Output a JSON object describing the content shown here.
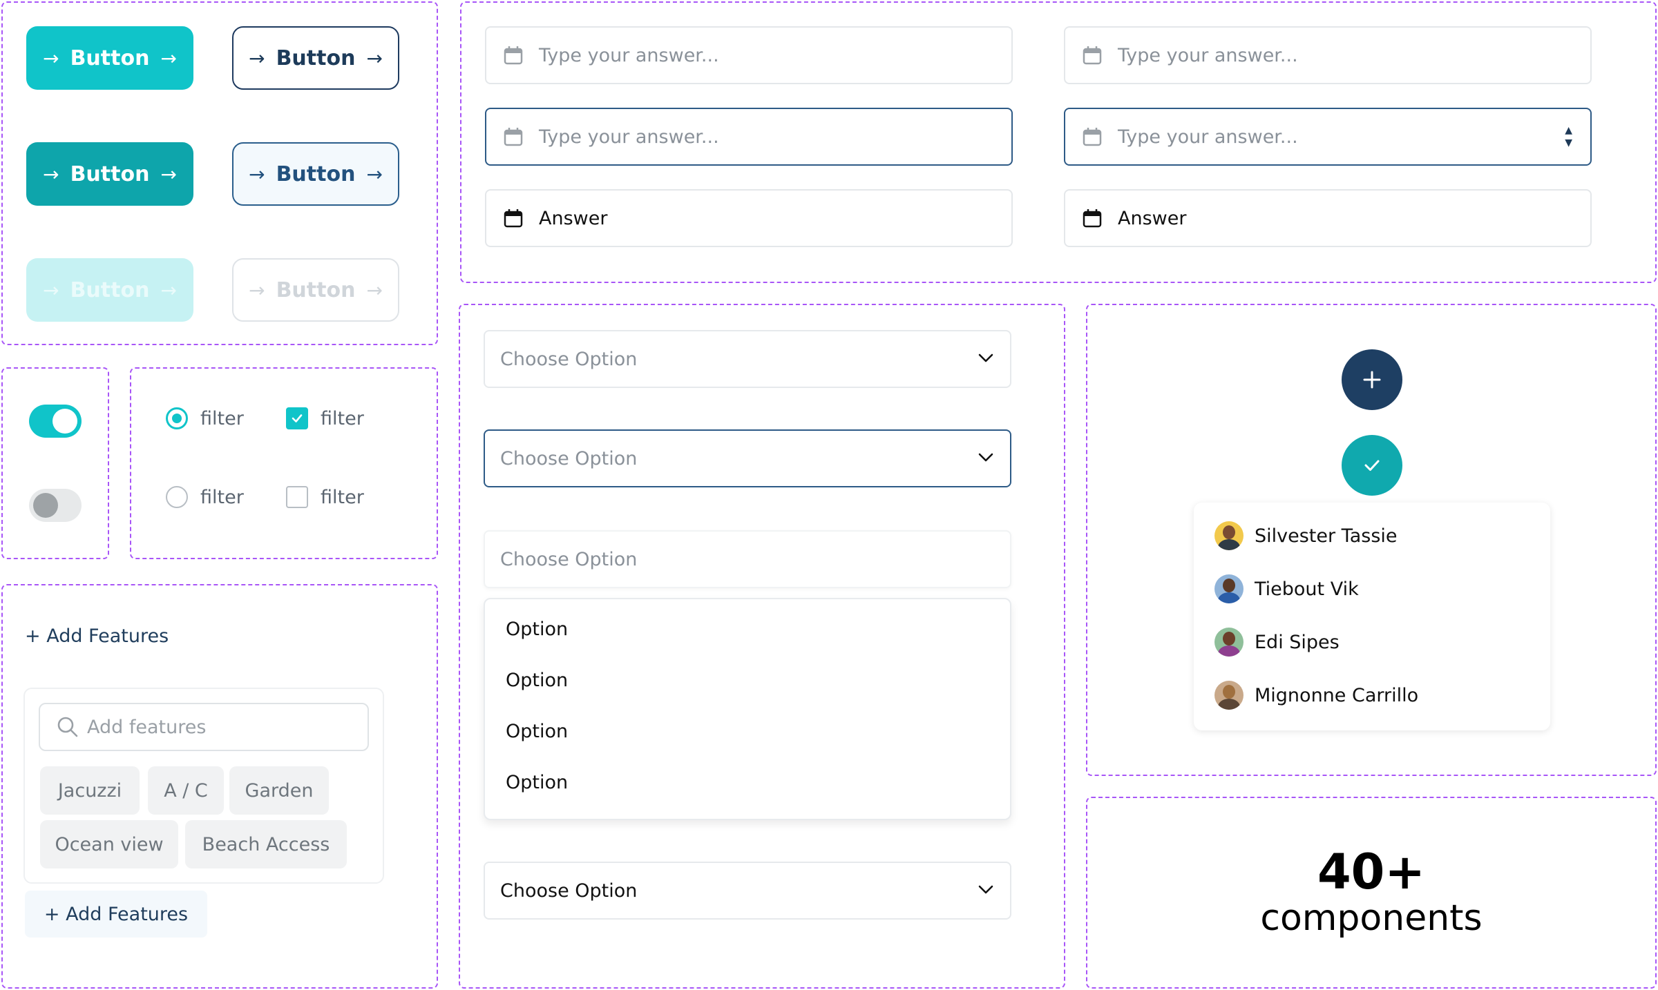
{
  "buttons": {
    "primary": "Button",
    "primary_pressed": "Button",
    "primary_disabled": "Button",
    "secondary": "Button",
    "secondary_hover": "Button",
    "secondary_disabled": "Button"
  },
  "toggles": [
    {
      "state": "on"
    },
    {
      "state": "off"
    }
  ],
  "choices": {
    "radio_checked": "filter",
    "radio_unchecked": "filter",
    "checkbox_checked": "filter",
    "checkbox_unchecked": "filter"
  },
  "inputs": {
    "placeholder": "Type your answer...",
    "value": "Answer"
  },
  "selects": {
    "placeholder": "Choose Option",
    "selected": "Choose Option",
    "options": [
      "Option",
      "Option",
      "Option",
      "Option"
    ]
  },
  "features": {
    "add_link": "+ Add Features",
    "search_placeholder": "Add features",
    "chips": [
      "Jacuzzi",
      "A / C",
      "Garden",
      "Ocean view",
      "Beach Access"
    ],
    "add_button": "+ Add Features"
  },
  "people": [
    {
      "name": "Silvester Tassie"
    },
    {
      "name": "Tiebout Vik"
    },
    {
      "name": "Edi Sipes"
    },
    {
      "name": "Mignonne Carrillo"
    }
  ],
  "promo": {
    "count": "40+",
    "label": "components"
  },
  "colors": {
    "accent_teal": "#10c4c9",
    "navy": "#1f3d5c",
    "panel_border": "#a855f7"
  }
}
